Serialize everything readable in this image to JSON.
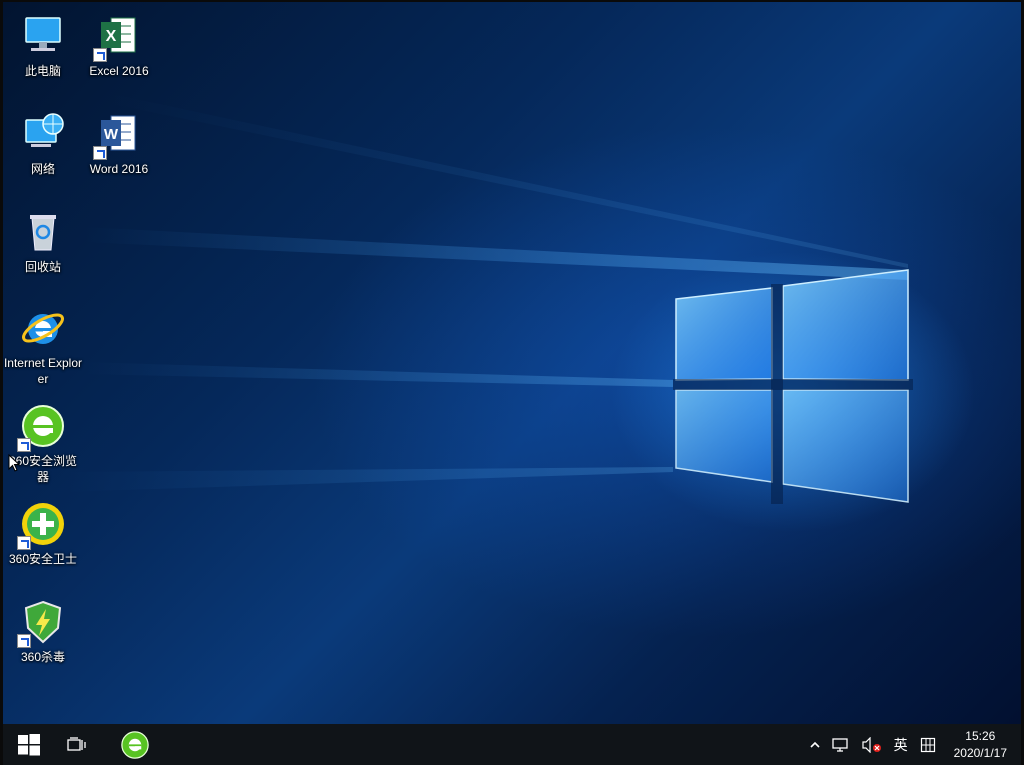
{
  "desktop": {
    "icons": [
      {
        "name": "此电脑",
        "icon": "computer-icon",
        "shortcut": false
      },
      {
        "name": "Excel 2016",
        "icon": "excel-icon",
        "shortcut": true
      },
      {
        "name": "网络",
        "icon": "network-icon",
        "shortcut": false
      },
      {
        "name": "Word 2016",
        "icon": "word-icon",
        "shortcut": true
      },
      {
        "name": "回收站",
        "icon": "recycle-bin-icon",
        "shortcut": false
      },
      {
        "name": "Internet Explorer",
        "icon": "internet-explorer-icon",
        "shortcut": false
      },
      {
        "name": "360安全浏览器",
        "icon": "360-browser-icon",
        "shortcut": true
      },
      {
        "name": "360安全卫士",
        "icon": "360-security-icon",
        "shortcut": true
      },
      {
        "name": "360杀毒",
        "icon": "360-antivirus-icon",
        "shortcut": true
      }
    ]
  },
  "taskbar": {
    "start_icon": "windows-logo-icon",
    "task_view_icon": "task-view-icon",
    "pinned": [
      {
        "icon": "360-browser-icon"
      }
    ],
    "tray": {
      "chevron_icon": "chevron-up-icon",
      "network_icon": "network-disconnected-icon",
      "volume_icon": "volume-muted-icon",
      "ime_label": "英",
      "ime_mode_icon": "ime-grid-icon"
    },
    "clock": {
      "time": "15:26",
      "date": "2020/1/17"
    }
  },
  "colors": {
    "taskbar": "#101418",
    "desktop_accent": "#1a73e8"
  }
}
